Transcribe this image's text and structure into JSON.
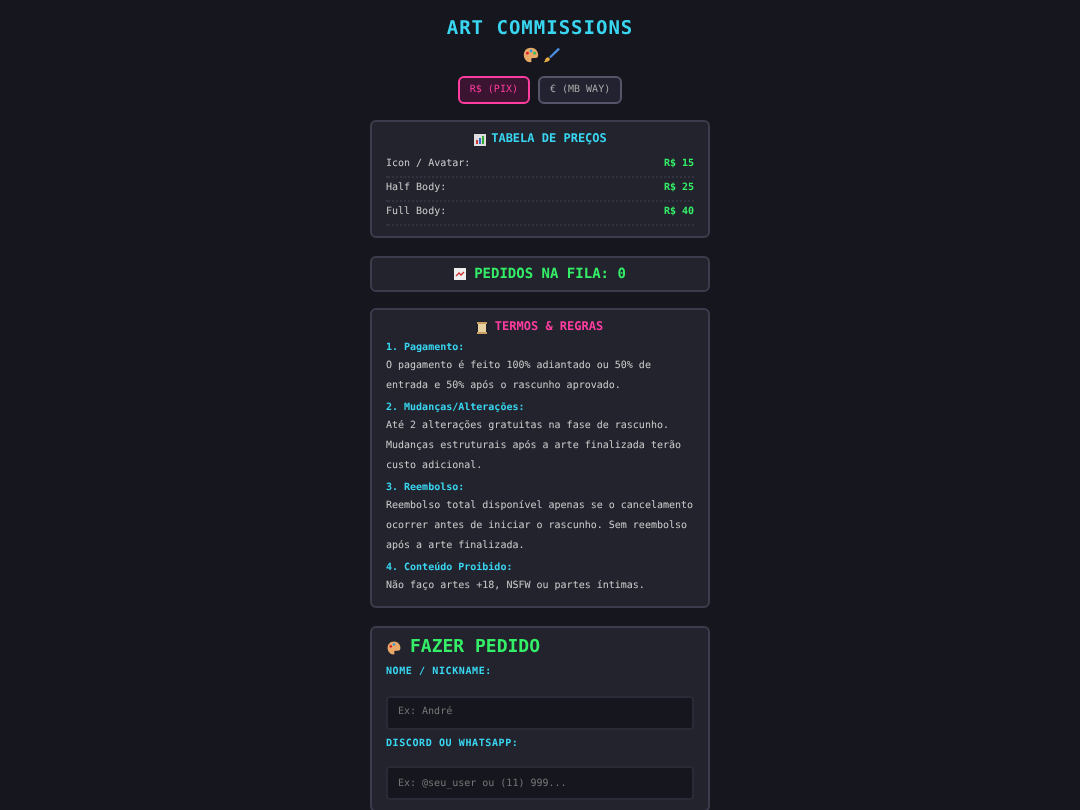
{
  "title": "ART COMMISSIONS",
  "currencies": [
    {
      "label": "R$ (PIX)",
      "selected": true
    },
    {
      "label": "€ (MB WAY)",
      "selected": false
    }
  ],
  "prices": {
    "title": "TABELA DE PREÇOS",
    "rows": [
      {
        "item": "Icon / Avatar:",
        "price": "R$ 15"
      },
      {
        "item": "Half Body:",
        "price": "R$ 25"
      },
      {
        "item": "Full Body:",
        "price": "R$ 40"
      }
    ]
  },
  "queue": {
    "label": "PEDIDOS NA FILA: 0"
  },
  "terms": {
    "title": "TERMOS & REGRAS",
    "sections": [
      {
        "heading": "1. Pagamento:",
        "text": "O pagamento é feito 100% adiantado ou 50% de entrada e 50% após o rascunho aprovado."
      },
      {
        "heading": "2. Mudanças/Alterações:",
        "text": "Até 2 alterações gratuitas na fase de rascunho. Mudanças estruturais após a arte finalizada terão custo adicional."
      },
      {
        "heading": "3. Reembolso:",
        "text": "Reembolso total disponível apenas se o cancelamento ocorrer antes de iniciar o rascunho. Sem reembolso após a arte finalizada."
      },
      {
        "heading": "4. Conteúdo Proibido:",
        "text": "Não faço artes +18, NSFW ou partes íntimas."
      }
    ]
  },
  "order": {
    "title": "FAZER PEDIDO",
    "fields": [
      {
        "label": "NOME / NICKNAME:",
        "placeholder": "Ex: André"
      },
      {
        "label": "DISCORD OU WHATSAPP:",
        "placeholder": "Ex: @seu_user ou (11) 999..."
      }
    ]
  }
}
